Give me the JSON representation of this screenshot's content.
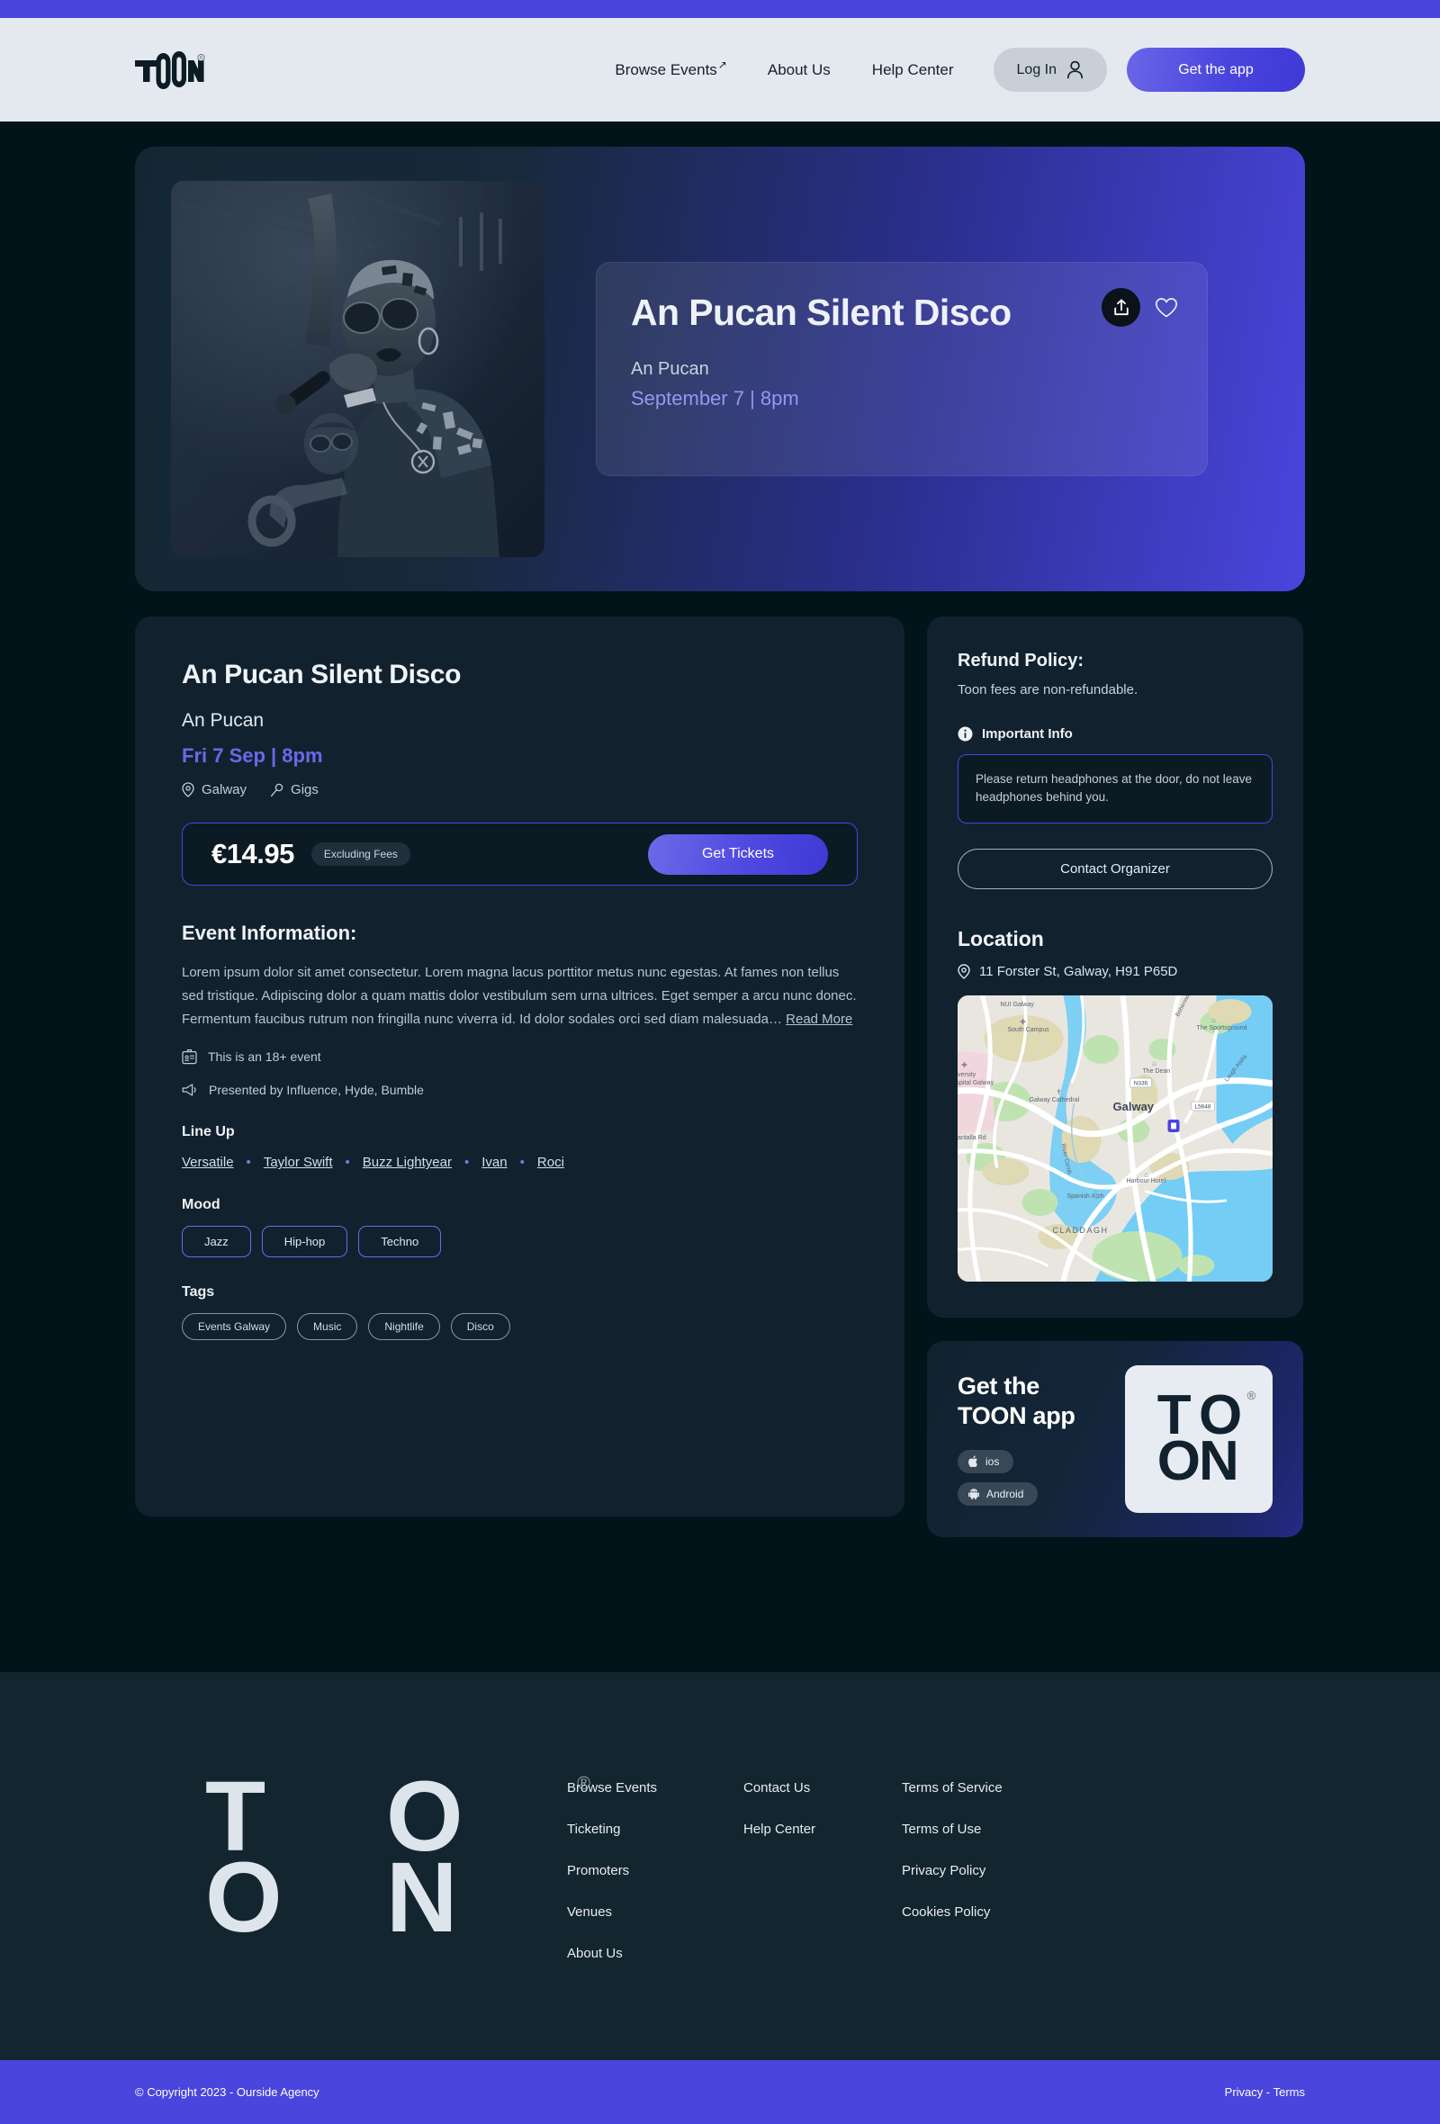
{
  "colors": {
    "accent": "#4a45dd",
    "page_bg": "#001419",
    "card_bg": "#11222e",
    "footer_bg": "#13252f",
    "header_bg": "#e4e9f0",
    "date_text": "#6e67e8"
  },
  "header": {
    "logo": "TOON",
    "logo_registered": "®",
    "nav": [
      {
        "label": "Browse Events",
        "external": true
      },
      {
        "label": "About Us",
        "external": false
      },
      {
        "label": "Help Center",
        "external": false
      }
    ],
    "login_label": "Log In",
    "get_app_label": "Get the app"
  },
  "hero": {
    "title": "An Pucan Silent Disco",
    "venue": "An Pucan",
    "date": "September 7  |  8pm",
    "share_icon": "share-icon",
    "favorite_icon": "heart-icon",
    "photo_alt": "singer-performing-photo"
  },
  "event": {
    "title": "An Pucan Silent Disco",
    "venue": "An Pucan",
    "date": "Fri 7 Sep  |  8pm",
    "city": "Galway",
    "category": "Gigs",
    "price": "€14.95",
    "fees_note": "Excluding Fees",
    "get_tickets_label": "Get Tickets",
    "info_heading": "Event Information:",
    "description": "Lorem ipsum dolor sit amet consectetur. Lorem magna lacus porttitor metus nunc egestas. At fames non tellus sed tristique. Adipiscing dolor a quam mattis dolor vestibulum sem urna ultrices. Eget semper a arcu nunc donec. Fermentum faucibus rutrum non fringilla nunc viverra id. Id dolor sodales orci sed diam malesuada…",
    "read_more_label": "Read More",
    "age_note": "This is an 18+ event",
    "presented_note": "Presented by Influence, Hyde, Bumble",
    "lineup_heading": "Line Up",
    "lineup": [
      "Versatile",
      "Taylor Swift",
      "Buzz Lightyear",
      "Ivan",
      "Roci"
    ],
    "mood_heading": "Mood",
    "moods": [
      "Jazz",
      "Hip-hop",
      "Techno"
    ],
    "tags_heading": "Tags",
    "tags": [
      "Events Galway",
      "Music",
      "Nightlife",
      "Disco"
    ]
  },
  "sidebar": {
    "refund_heading": "Refund Policy:",
    "refund_text": "Toon fees are non-refundable.",
    "important_info_label": "Important Info",
    "important_info_text": "Please return headphones at the door, do not leave headphones behind you.",
    "contact_label": "Contact Organizer",
    "location_heading": "Location",
    "address": "11 Forster St, Galway, H91 P65D",
    "map_labels": {
      "city": "Galway",
      "nui": "NUI Galway",
      "south_campus": "South Campus",
      "hospital": "University Hospital Galway",
      "cathedral": "Galway Cathedral",
      "shantalla": "Shantalla Rd",
      "spanish_arch": "Spanish Arch",
      "claddagh": "CLADDAGH",
      "harbour": "Harbour Hotel",
      "the_dean": "The Dean",
      "sportsground": "The Sportsground",
      "river": "River Corrib",
      "bohermore": "Bohermore",
      "lough": "Lough Atalia",
      "road_a": "N336",
      "road_b": "L5648"
    }
  },
  "app_card": {
    "title_line1": "Get the",
    "title_line2": "TOON app",
    "ios_label": "ios",
    "android_label": "Android",
    "logo_top_left": "T",
    "logo_top_right": "O",
    "logo_bottom_left": "O",
    "logo_bottom_right": "N",
    "logo_registered": "®"
  },
  "footer": {
    "logo_top_left": "T",
    "logo_top_right": "O",
    "logo_bottom_left": "O",
    "logo_bottom_right": "N",
    "logo_registered": "®",
    "columns": [
      {
        "links": [
          "Browse Events",
          "Ticketing",
          "Promoters",
          "Venues",
          "About Us"
        ]
      },
      {
        "links": [
          "Contact Us",
          "Help Center"
        ]
      },
      {
        "links": [
          "Terms of Service",
          "Terms of Use",
          "Privacy Policy",
          "Cookies Policy"
        ]
      }
    ],
    "copyright": "© Copyright 2023 - Ourside Agency",
    "legal_links": "Privacy - Terms"
  }
}
